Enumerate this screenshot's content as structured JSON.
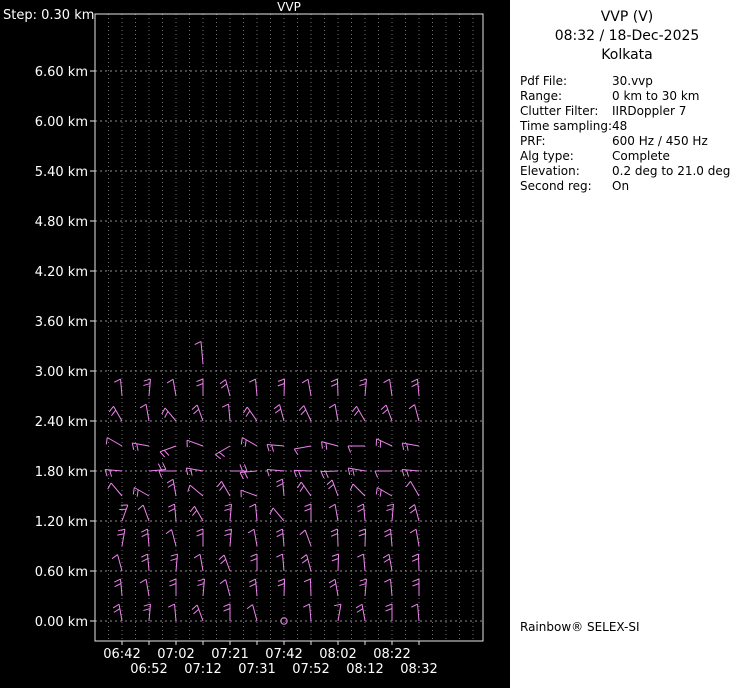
{
  "panel": {
    "title": "VVP (V)",
    "datetime": "08:32 / 18-Dec-2025",
    "site": "Kolkata",
    "info": [
      {
        "label": "Pdf File:",
        "value": "30.vvp"
      },
      {
        "label": "Range:",
        "value": "0 km to 30 km"
      },
      {
        "label": "Clutter Filter:",
        "value": "IIRDoppler 7"
      },
      {
        "label": "Time sampling:",
        "value": "48"
      },
      {
        "label": "PRF:",
        "value": "600 Hz / 450 Hz"
      },
      {
        "label": "Alg type:",
        "value": "Complete"
      },
      {
        "label": "Elevation:",
        "value": "0.2 deg to 21.0 deg"
      },
      {
        "label": "Second reg:",
        "value": "On"
      }
    ],
    "footer": "Rainbow® SELEX-SI"
  },
  "chart_data": {
    "type": "wind-barb-time-height",
    "title": "VVP",
    "step_label": "Step: 0.30 km",
    "y_unit": "km",
    "y_step_km": 0.3,
    "y_ticks": [
      "6.60 km",
      "6.00 km",
      "5.40 km",
      "4.80 km",
      "4.20 km",
      "3.60 km",
      "3.00 km",
      "2.40 km",
      "1.80 km",
      "1.20 km",
      "0.60 km",
      "0.00 km"
    ],
    "times": [
      "06:42",
      "06:52",
      "07:02",
      "07:12",
      "07:21",
      "07:31",
      "07:42",
      "07:52",
      "08:02",
      "08:12",
      "08:22",
      "08:32"
    ],
    "colors": {
      "barb": "#ee82ee",
      "grid": "#8c8c8c",
      "frame": "#e6e6e6",
      "text": "#ffffff",
      "chart_bg": "#000000",
      "panel_bg": "#ffffff"
    },
    "rows": [
      {
        "h": 2.7,
        "angles": [
          95,
          85,
          100,
          90,
          105,
          95,
          88,
          100,
          92,
          85,
          98,
          95
        ],
        "ticks": [
          1,
          2,
          1,
          2,
          2,
          1,
          2,
          1,
          2,
          2,
          1,
          2
        ]
      },
      {
        "h": 2.4,
        "angles": [
          120,
          100,
          130,
          110,
          95,
          125,
          105,
          115,
          100,
          120,
          110,
          105
        ],
        "ticks": [
          2,
          1,
          2,
          2,
          1,
          2,
          2,
          2,
          1,
          2,
          2,
          1
        ]
      },
      {
        "h": 2.1,
        "angles": [
          150,
          170,
          200,
          160,
          210,
          150,
          175,
          190,
          165,
          180,
          155,
          170
        ],
        "ticks": [
          1,
          2,
          2,
          1,
          2,
          2,
          2,
          1,
          2,
          1,
          2,
          2
        ]
      },
      {
        "h": 1.8,
        "angles": [
          175,
          5,
          180,
          170,
          0,
          185,
          175,
          178,
          182,
          170,
          180,
          175
        ],
        "ticks": [
          2,
          2,
          1,
          2,
          2,
          2,
          1,
          2,
          2,
          2,
          1,
          2
        ]
      },
      {
        "h": 1.5,
        "angles": [
          130,
          150,
          100,
          140,
          120,
          160,
          95,
          125,
          110,
          135,
          150,
          120
        ],
        "ticks": [
          1,
          2,
          2,
          1,
          2,
          1,
          2,
          2,
          2,
          1,
          2,
          1
        ]
      },
      {
        "h": 1.2,
        "angles": [
          70,
          110,
          95,
          120,
          85,
          95,
          130,
          90,
          100,
          95,
          85,
          105
        ],
        "ticks": [
          2,
          1,
          2,
          2,
          2,
          1,
          1,
          2,
          1,
          2,
          2,
          2
        ]
      },
      {
        "h": 0.9,
        "angles": [
          80,
          95,
          105,
          90,
          85,
          100,
          95,
          110,
          92,
          88,
          95,
          100
        ],
        "ticks": [
          2,
          2,
          1,
          2,
          2,
          1,
          2,
          1,
          2,
          2,
          2,
          1
        ]
      },
      {
        "h": 0.6,
        "angles": [
          105,
          95,
          85,
          100,
          110,
          90,
          95,
          105,
          88,
          95,
          100,
          92
        ],
        "ticks": [
          1,
          2,
          2,
          1,
          2,
          2,
          1,
          2,
          2,
          1,
          2,
          2
        ]
      },
      {
        "h": 0.3,
        "angles": [
          95,
          100,
          90,
          85,
          105,
          95,
          88,
          92,
          100,
          85,
          95,
          90
        ],
        "ticks": [
          2,
          1,
          2,
          2,
          1,
          2,
          2,
          1,
          2,
          2,
          1,
          2
        ]
      },
      {
        "h": 0.0,
        "angles": [
          100,
          85,
          95,
          110,
          90,
          105,
          null,
          95,
          80,
          100,
          90,
          95
        ],
        "ticks": [
          2,
          2,
          1,
          2,
          2,
          1,
          0,
          1,
          1,
          2,
          2,
          1
        ]
      }
    ],
    "extra_barbs": [
      {
        "h": 3.08,
        "col": 3,
        "angle": 95,
        "ticks": 1,
        "len": 23
      }
    ],
    "calm": [
      {
        "h": 0.0,
        "col": 6
      }
    ]
  }
}
